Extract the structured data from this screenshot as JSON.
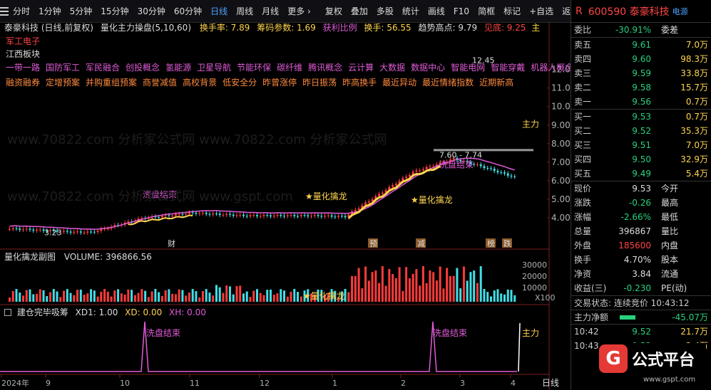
{
  "toolbar": {
    "left": [
      "分时",
      "1分钟",
      "5分钟",
      "15分钟",
      "30分钟",
      "60分钟",
      "日线",
      "周线",
      "月线",
      "更多 ›"
    ],
    "active_index": 6,
    "right": [
      "复权",
      "叠加",
      "多股",
      "统计",
      "画线",
      "F10",
      "简框",
      "标记",
      "+自选",
      "返回"
    ]
  },
  "main": {
    "title": "泰豪科技 (日线,前复权)",
    "indicator": "量化主力操盘(5,10,60)",
    "turnover_label": "换手率: 7.89",
    "chip_label": "筹码参数: 1.69",
    "profit_label": "获利比例",
    "change_label": "换手: 56.55",
    "trend_label": "趋势高点: 9.79",
    "risk_label": "见底: 9.25",
    "main_label": "主",
    "concept1": "军工电子",
    "concept2": "江西板块",
    "tags1": [
      "一带一路",
      "国防军工",
      "军民融合",
      "创投概念",
      "氢能源",
      "卫星导航",
      "节能环保",
      "碳纤维",
      "腾讯概念",
      "云计算",
      "大数据",
      "数据中心",
      "智能电网",
      "智能穿戴",
      "机器人概念"
    ],
    "tags2": [
      "融资融券",
      "定增预案",
      "并购重组预案",
      "商誉减值",
      "高校背景",
      "低安全分",
      "昨曾涨停",
      "昨日振荡",
      "昨高换手",
      "最近异动",
      "最近情绪指数",
      "近期新高"
    ],
    "annotations": {
      "high": "12.45",
      "low": "3.23",
      "range": "7.60 - 7.74",
      "wash1": "洗盘结束",
      "wash2": "洗盘结束",
      "dragon1": "量化擒龙",
      "dragon2": "量化擒龙",
      "main_force": "主力"
    },
    "markers": [
      "财",
      "预",
      "减",
      "榜",
      "跌"
    ],
    "y_ticks": [
      "12.00",
      "11.00",
      "10.00",
      "9.00",
      "8.00",
      "7.00",
      "6.00",
      "5.00",
      "4.00"
    ],
    "watermark": "www.70822.com 分析家公式网",
    "watermark2": "www.gspt.com"
  },
  "vol": {
    "title": "量化擒龙副图",
    "volume": "VOLUME: 396866.56",
    "y_ticks": [
      "30000",
      "20000",
      "10000"
    ],
    "unit": "X100",
    "dragon": "量化擒龙"
  },
  "sub": {
    "title": "建仓完毕吸筹",
    "xd1": "XD1: 1.00",
    "xd": "XD: 0.00",
    "xh": "XH: 0.00",
    "wash": "洗盘结束",
    "main_force": "主力"
  },
  "xaxis": {
    "labels": [
      "2024年",
      "9",
      "10",
      "11",
      "12",
      "1",
      "2",
      "3",
      "4"
    ],
    "right": "日线"
  },
  "quote": {
    "code": "R",
    "name": "600590 泰豪科技",
    "source": "电源",
    "webi_label": "委比",
    "webi_value": "-30.91%",
    "webi_right": "委差",
    "asks": [
      {
        "label": "卖五",
        "price": "9.61",
        "vol": "7.0万"
      },
      {
        "label": "卖四",
        "price": "9.60",
        "vol": "98.3万"
      },
      {
        "label": "卖三",
        "price": "9.59",
        "vol": "33.8万"
      },
      {
        "label": "卖二",
        "price": "9.58",
        "vol": "15.7万"
      },
      {
        "label": "卖一",
        "price": "9.56",
        "vol": "0.7万"
      }
    ],
    "bids": [
      {
        "label": "买一",
        "price": "9.53",
        "vol": "0.7万"
      },
      {
        "label": "买二",
        "price": "9.52",
        "vol": "35.3万"
      },
      {
        "label": "买三",
        "price": "9.51",
        "vol": "7.0万"
      },
      {
        "label": "买四",
        "price": "9.50",
        "vol": "32.9万"
      },
      {
        "label": "买五",
        "price": "9.49",
        "vol": "5.4万"
      }
    ],
    "stats": [
      {
        "l": "现价",
        "v": "9.53",
        "r": "今开"
      },
      {
        "l": "涨跌",
        "v": "-0.26",
        "r": "最高"
      },
      {
        "l": "涨幅",
        "v": "-2.66%",
        "r": "最低"
      },
      {
        "l": "总量",
        "v": "396867",
        "r": "量比"
      },
      {
        "l": "外盘",
        "v": "185600",
        "r": "内盘"
      },
      {
        "l": "换手",
        "v": "4.70%",
        "r": "股本"
      },
      {
        "l": "净资",
        "v": "3.84",
        "r": "流通"
      },
      {
        "l": "收益(三)",
        "v": "-0.230",
        "r": "PE(动)"
      }
    ],
    "trade_status": "交易状态: 连续竞价 10:43:12",
    "net_label": "主力净额",
    "net_value": "-45.07万",
    "ticks": [
      {
        "t": "10:42",
        "p": "9.52",
        "v": "21.7万"
      },
      {
        "t": "10:43",
        "p": "9.52",
        "v": "2.4万"
      }
    ],
    "logo_text": "公式平台",
    "logo_url": "www.gspt.com"
  }
}
